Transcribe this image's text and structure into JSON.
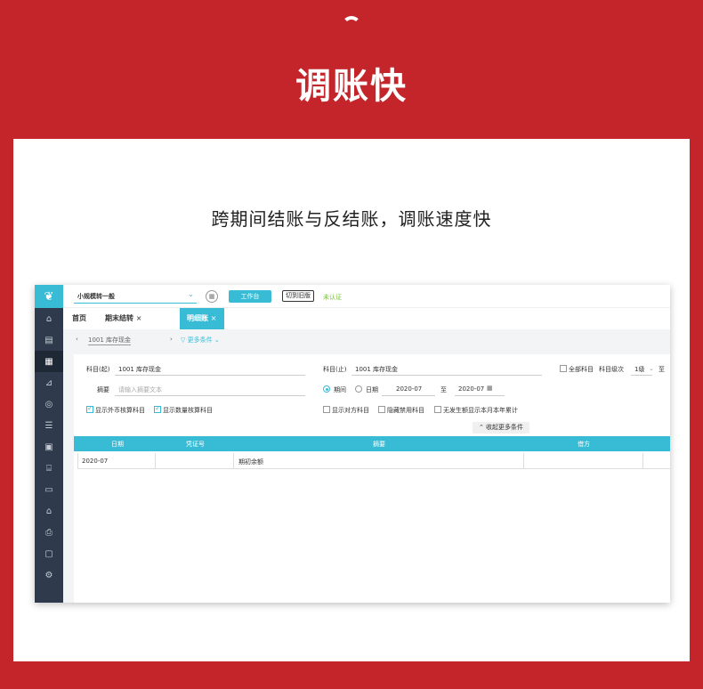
{
  "hero": {
    "title": "调账快"
  },
  "card": {
    "subtitle": "跨期间结账与反结账，调账速度快"
  },
  "app": {
    "company": "小规模转一般",
    "workbench_label": "工作台",
    "switch_label": "切到旧版",
    "uncertified_label": "未认证",
    "tabs": [
      {
        "label": "首页"
      },
      {
        "label": "期末结转",
        "close": "×"
      },
      {
        "label": "明细账",
        "close": "×"
      }
    ],
    "breadcrumb": {
      "current": "1001 库存现金",
      "more_filters": "更多条件"
    },
    "form": {
      "subject_from_label": "科目(起)",
      "subject_from_value": "1001 库存现金",
      "subject_to_label": "科目(止)",
      "subject_to_value": "1001 库存现金",
      "all_subjects_label": "全部科目",
      "level_label": "科目级次",
      "level_value": "1级",
      "level_to": "至",
      "summary_label": "摘要",
      "summary_placeholder": "请输入摘要文本",
      "period_label": "期间",
      "date_label": "日期",
      "period_from": "2020-07",
      "period_sep": "至",
      "period_to": "2020-07",
      "opt_foreign": "显示外币核算科目",
      "opt_quantity": "显示数量核算科目",
      "opt_counter": "显示对方科目",
      "opt_hide_disabled": "隐藏禁用科目",
      "opt_no_amount": "无发生额显示本月本年累计",
      "collapse_label": "收起更多条件"
    },
    "table": {
      "headers": [
        "日期",
        "凭证号",
        "摘要",
        "借方"
      ],
      "rows": [
        {
          "date": "2020-07",
          "voucher": "",
          "summary": "期初余额",
          "debit": ""
        }
      ]
    }
  }
}
